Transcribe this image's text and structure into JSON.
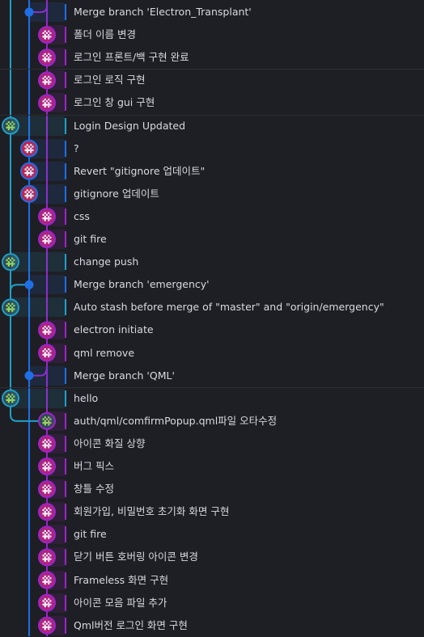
{
  "colors": {
    "background": "#1e1f24",
    "lane_teal": "#1fa0c8",
    "lane_blue": "#1e6fe6",
    "lane_purple": "#9b24c8",
    "lane_purple_dark": "#7a1d9e",
    "avatar_bg_purple": "#b2237a",
    "avatar_bg_blue": "#c22350",
    "avatar_bg_teal": "#2f4a56"
  },
  "commits": [
    {
      "message": "Merge branch 'Electron_Transplant'",
      "lane": 1,
      "kind": "merge",
      "color": "lane_blue"
    },
    {
      "message": "폴더 이름 변경",
      "lane": 2,
      "kind": "avatar",
      "color": "lane_purple"
    },
    {
      "message": "로그인 프론트/백 구현 완료",
      "lane": 2,
      "kind": "avatar",
      "color": "lane_purple"
    },
    {
      "message": "로그인 로직 구현",
      "lane": 2,
      "kind": "avatar",
      "color": "lane_purple"
    },
    {
      "message": "로그인 창 gui 구현",
      "lane": 2,
      "kind": "avatar",
      "color": "lane_purple"
    },
    {
      "message": "Login Design Updated",
      "lane": 0,
      "kind": "avatar-green",
      "color": "lane_teal"
    },
    {
      "message": "?",
      "lane": 1,
      "kind": "avatar-blue",
      "color": "lane_blue"
    },
    {
      "message": "Revert \"gitignore 업데이트\"",
      "lane": 1,
      "kind": "avatar-blue",
      "color": "lane_blue"
    },
    {
      "message": "gitignore 업데이트",
      "lane": 1,
      "kind": "avatar-blue",
      "color": "lane_blue"
    },
    {
      "message": "css",
      "lane": 2,
      "kind": "avatar",
      "color": "lane_purple"
    },
    {
      "message": "git fire",
      "lane": 2,
      "kind": "avatar",
      "color": "lane_purple"
    },
    {
      "message": "change push",
      "lane": 0,
      "kind": "avatar-green",
      "color": "lane_teal"
    },
    {
      "message": "Merge branch 'emergency'",
      "lane": 1,
      "kind": "merge",
      "color": "lane_blue"
    },
    {
      "message": "Auto stash before merge of \"master\" and \"origin/emergency\"",
      "lane": 0,
      "kind": "avatar-green",
      "color": "lane_teal"
    },
    {
      "message": "electron initiate",
      "lane": 2,
      "kind": "avatar",
      "color": "lane_purple"
    },
    {
      "message": "qml remove",
      "lane": 2,
      "kind": "avatar",
      "color": "lane_purple"
    },
    {
      "message": "Merge branch 'QML'",
      "lane": 1,
      "kind": "merge",
      "color": "lane_blue"
    },
    {
      "message": "hello",
      "lane": 0,
      "kind": "avatar-green",
      "color": "lane_teal"
    },
    {
      "message": "auth/qml/comfirmPopup.qml파일 오타수정",
      "lane": 2,
      "kind": "avatar-green",
      "color": "lane_purple"
    },
    {
      "message": "아이콘 화질 상향",
      "lane": 2,
      "kind": "avatar",
      "color": "lane_purple"
    },
    {
      "message": "버그 픽스",
      "lane": 2,
      "kind": "avatar",
      "color": "lane_purple"
    },
    {
      "message": "창틀 수정",
      "lane": 2,
      "kind": "avatar",
      "color": "lane_purple"
    },
    {
      "message": "회원가입, 비밀번호 초기화 화면 구현",
      "lane": 2,
      "kind": "avatar",
      "color": "lane_purple"
    },
    {
      "message": "git fire",
      "lane": 2,
      "kind": "avatar",
      "color": "lane_purple"
    },
    {
      "message": "닫기 버튼 호버링 아이콘 변경",
      "lane": 2,
      "kind": "avatar",
      "color": "lane_purple"
    },
    {
      "message": "Frameless 화면 구현",
      "lane": 2,
      "kind": "avatar",
      "color": "lane_purple"
    },
    {
      "message": "아이콘 모음 파일 추가",
      "lane": 2,
      "kind": "avatar",
      "color": "lane_purple"
    },
    {
      "message": "Qml버전 로그인 화면 구현",
      "lane": 2,
      "kind": "avatar",
      "color": "lane_purple"
    }
  ]
}
